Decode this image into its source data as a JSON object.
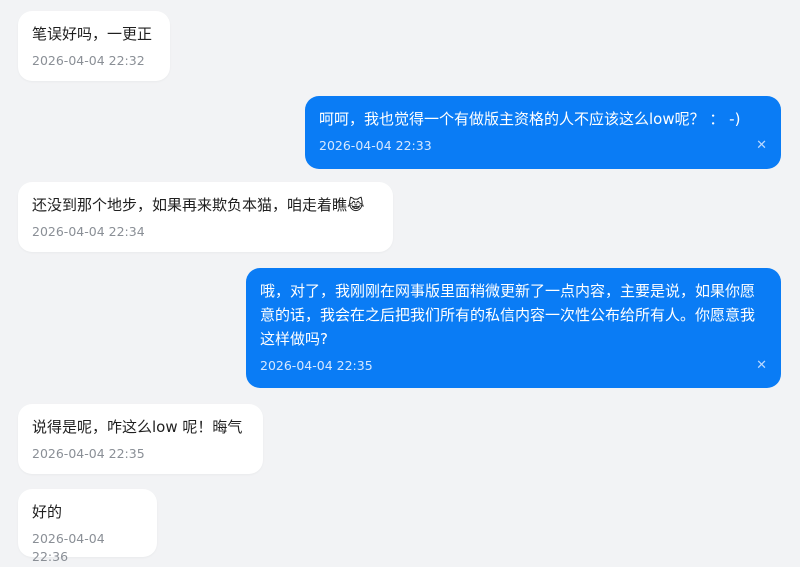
{
  "messages": [
    {
      "direction": "in",
      "text": "笔误好吗，一更正",
      "time": "2026-04-04 22:32"
    },
    {
      "direction": "out",
      "text": "呵呵，我也觉得一个有做版主资格的人不应该这么low呢？ ： -)",
      "time": "2026-04-04 22:33",
      "delete_icon": "✕"
    },
    {
      "direction": "in",
      "text": "还没到那个地步，如果再来欺负本猫，咱走着瞧😹",
      "time": "2026-04-04 22:34"
    },
    {
      "direction": "out",
      "text": "哦，对了，我刚刚在网事版里面稍微更新了一点内容，主要是说，如果你愿意的话，我会在之后把我们所有的私信内容一次性公布给所有人。你愿意我这样做吗?",
      "time": "2026-04-04 22:35",
      "delete_icon": "✕"
    },
    {
      "direction": "in",
      "text": "说得是呢，咋这么low 呢！晦气",
      "time": "2026-04-04 22:35"
    },
    {
      "direction": "in",
      "text": "好的",
      "time": "2026-04-04 22:36"
    }
  ]
}
